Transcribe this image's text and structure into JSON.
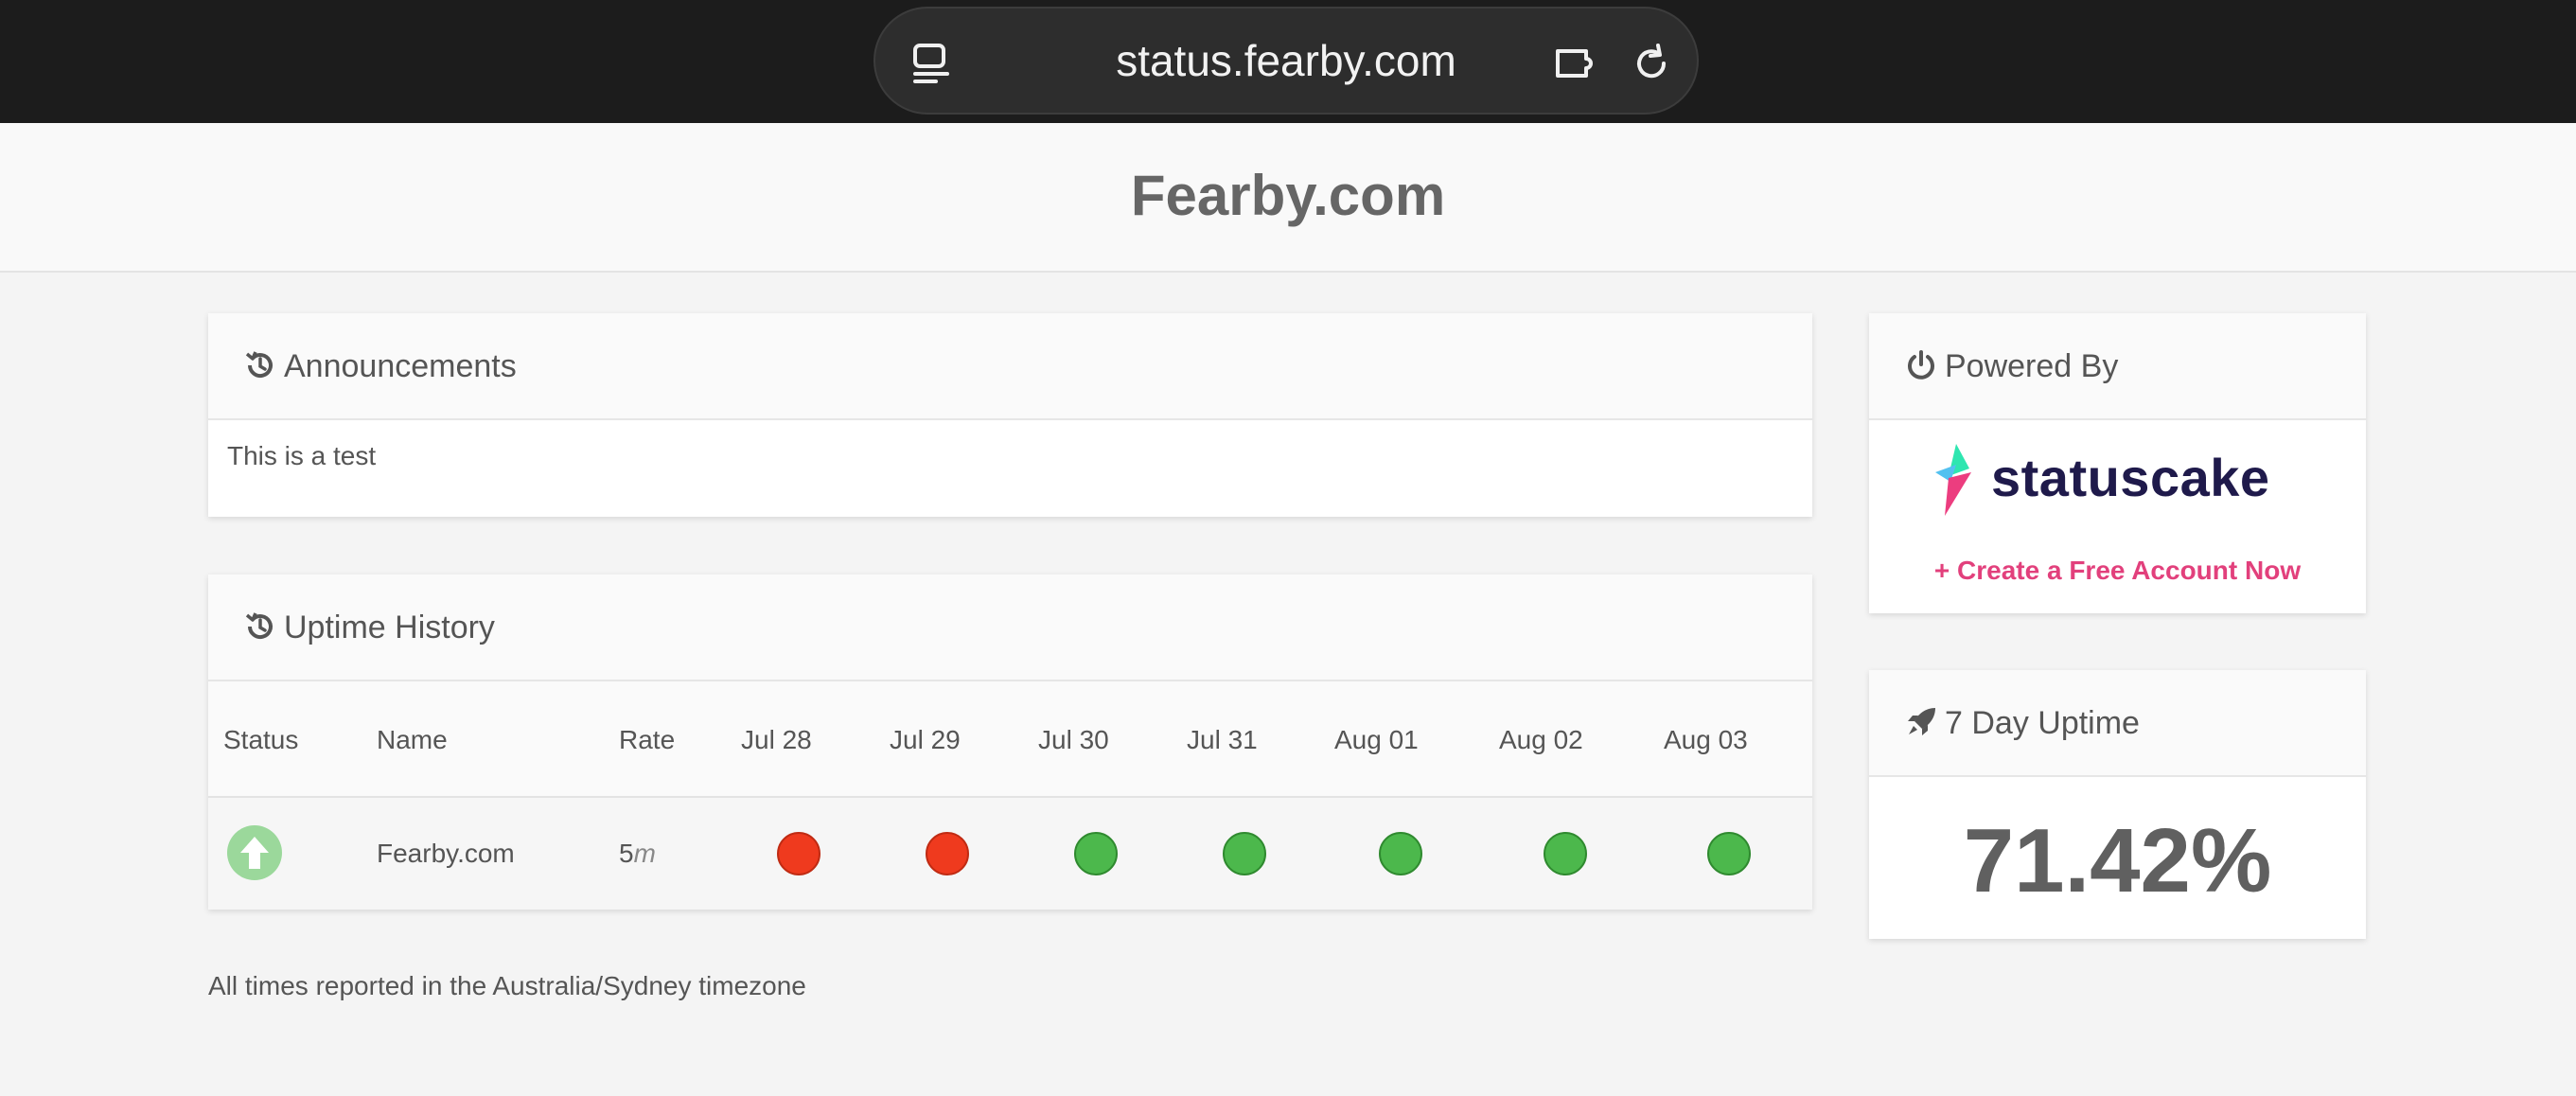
{
  "browser": {
    "url": "status.fearby.com"
  },
  "header": {
    "title": "Fearby.com"
  },
  "announcements": {
    "title": "Announcements",
    "icon": "history-icon",
    "message": "This is a test"
  },
  "uptime_history": {
    "title": "Uptime History",
    "icon": "history-icon",
    "columns": [
      "Status",
      "Name",
      "Rate",
      "Jul 28",
      "Jul 29",
      "Jul 30",
      "Jul 31",
      "Aug 01",
      "Aug 02",
      "Aug 03"
    ],
    "rows": [
      {
        "status": "up",
        "name": "Fearby.com",
        "rate_value": "5",
        "rate_unit": "m",
        "days": [
          "down",
          "down",
          "up",
          "up",
          "up",
          "up",
          "up"
        ]
      }
    ],
    "colors": {
      "up": "#4cb84c",
      "down": "#ef3a1e"
    }
  },
  "footer": {
    "timezone_note": "All times reported in the Australia/Sydney timezone"
  },
  "powered_by": {
    "title": "Powered By",
    "icon": "power-icon",
    "logo_text": "statuscake",
    "cta": "+ Create a Free Account Now",
    "cta_color": "#e2407c"
  },
  "seven_day": {
    "title": "7 Day Uptime",
    "icon": "rocket-icon",
    "value": "71.42%"
  }
}
